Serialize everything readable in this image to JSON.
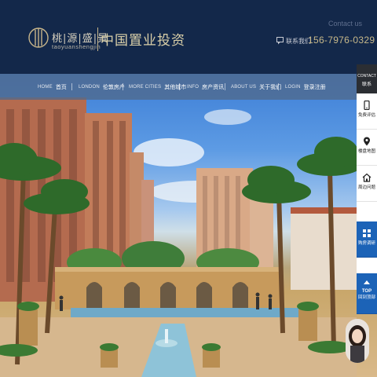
{
  "header": {
    "logo_cn": "桃|源|盛|景",
    "logo_pinyin": "taoyuanshengjin",
    "slogan": "中国置业投资",
    "contact_en": "Contact us",
    "contact_cn": "联系我们",
    "phone": "156-7976-0329"
  },
  "nav": [
    {
      "en": "HOME",
      "cn": "首页"
    },
    {
      "en": "LONDON",
      "cn": "伦敦房产"
    },
    {
      "en": "MORE CITIES",
      "cn": "其他城市"
    },
    {
      "en": "INFO",
      "cn": "房产资讯"
    },
    {
      "en": "ABOUT US",
      "cn": "关于我们"
    },
    {
      "en": "LOGIN",
      "cn": "登录注册"
    }
  ],
  "sidebar": {
    "head_en": "CONTACT",
    "head_cn": "联系",
    "items": [
      {
        "label": "免费评估",
        "icon": "phone-icon"
      },
      {
        "label": "楼盘地图",
        "icon": "map-pin-icon"
      },
      {
        "label": "周边问题",
        "icon": "home-icon"
      },
      {
        "label": "购房调研",
        "icon": "grid-icon"
      },
      {
        "label": "回到顶部",
        "top": "TOP",
        "icon": "arrow-up-icon"
      }
    ]
  },
  "colors": {
    "header_bg": "#13284a",
    "accent_gold": "#c8b98a",
    "side_blue": "#1c63b7"
  }
}
